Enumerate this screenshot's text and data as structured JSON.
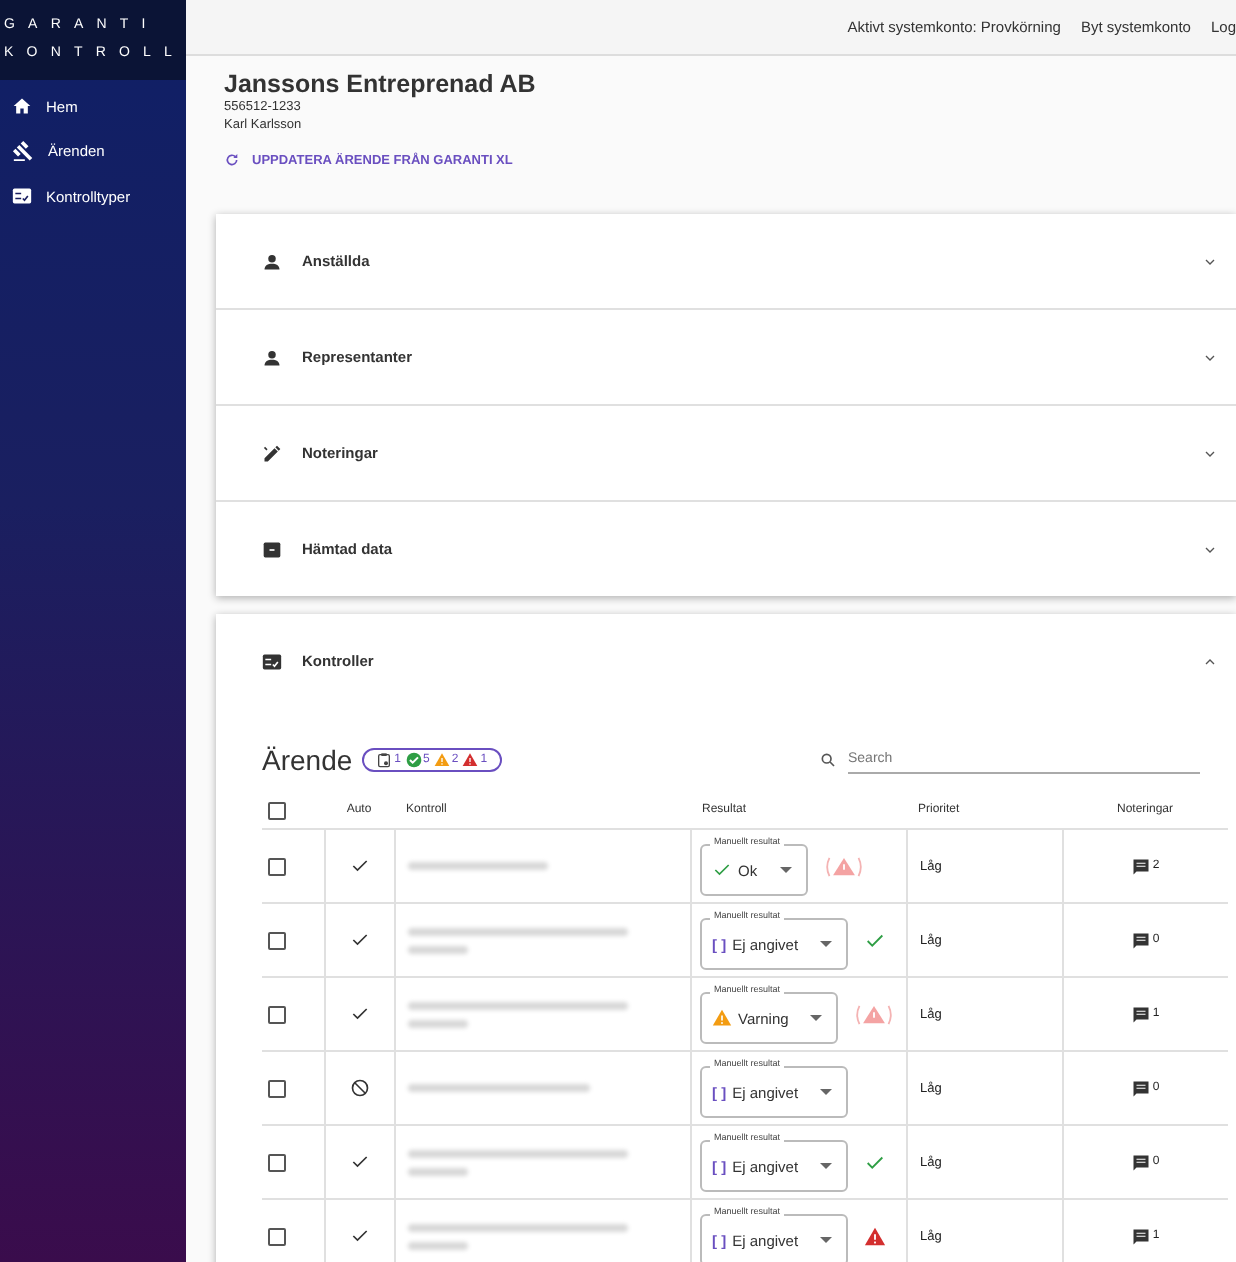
{
  "logo": {
    "line_1": "GARANTI",
    "line_2": "KONTROLL"
  },
  "sidebar": {
    "items": [
      {
        "label": "Hem"
      },
      {
        "label": "Ärenden"
      },
      {
        "label": "Kontrolltyper"
      }
    ]
  },
  "top_bar": {
    "links": [
      "Aktivt systemkonto: Provkörning",
      "Byt systemkonto",
      "Log"
    ]
  },
  "case": {
    "company": "Janssons Entreprenad AB",
    "org_number": "556512-1233",
    "person": "Karl Karlsson",
    "update_button": "UPPDATERA ÄRENDE FRÅN GARANTI XL"
  },
  "panels": [
    {
      "title": "Anställda",
      "expanded": false
    },
    {
      "title": "Representanter",
      "expanded": false
    },
    {
      "title": "Noteringar",
      "expanded": false
    },
    {
      "title": "Hämtad data",
      "expanded": false
    }
  ],
  "controls_panel": {
    "title": "Kontroller",
    "expanded": true,
    "table_title": "Ärende",
    "summary": [
      {
        "kind": "clipboard",
        "count": "1"
      },
      {
        "kind": "ok",
        "count": "5"
      },
      {
        "kind": "warning",
        "count": "2"
      },
      {
        "kind": "error",
        "count": "1"
      }
    ],
    "search": {
      "placeholder": "Search"
    },
    "columns": [
      "Auto",
      "Kontroll",
      "Resultat",
      "Prioritet",
      "Noteringar"
    ],
    "header_checked": false,
    "rows": [
      {
        "checked": false,
        "auto": {
          "kind": "check"
        },
        "result": {
          "label": "Manuellt resultat",
          "kind": "ok",
          "value": "Ok"
        },
        "status": {
          "kind": "faded-error"
        },
        "priority": "Låg",
        "notes": "2"
      },
      {
        "checked": false,
        "auto": {
          "kind": "check"
        },
        "result": {
          "label": "Manuellt resultat",
          "kind": "none",
          "marker": "[ ]",
          "value": "Ej angivet"
        },
        "status": {
          "kind": "ok"
        },
        "priority": "Låg",
        "notes": "0"
      },
      {
        "checked": false,
        "auto": {
          "kind": "check"
        },
        "result": {
          "label": "Manuellt resultat",
          "kind": "warning",
          "value": "Varning"
        },
        "status": {
          "kind": "faded-error"
        },
        "priority": "Låg",
        "notes": "1"
      },
      {
        "checked": false,
        "auto": {
          "kind": "blocked"
        },
        "result": {
          "label": "Manuellt resultat",
          "kind": "none",
          "marker": "[ ]",
          "value": "Ej angivet"
        },
        "priority": "Låg",
        "notes": "0"
      },
      {
        "checked": false,
        "auto": {
          "kind": "check"
        },
        "result": {
          "label": "Manuellt resultat",
          "kind": "none",
          "marker": "[ ]",
          "value": "Ej angivet"
        },
        "status": {
          "kind": "ok"
        },
        "priority": "Låg",
        "notes": "0"
      },
      {
        "checked": false,
        "auto": {
          "kind": "check"
        },
        "result": {
          "label": "Manuellt resultat",
          "kind": "none",
          "marker": "[ ]",
          "value": "Ej angivet"
        },
        "status": {
          "kind": "error"
        },
        "priority": "Låg",
        "notes": "1"
      }
    ]
  }
}
